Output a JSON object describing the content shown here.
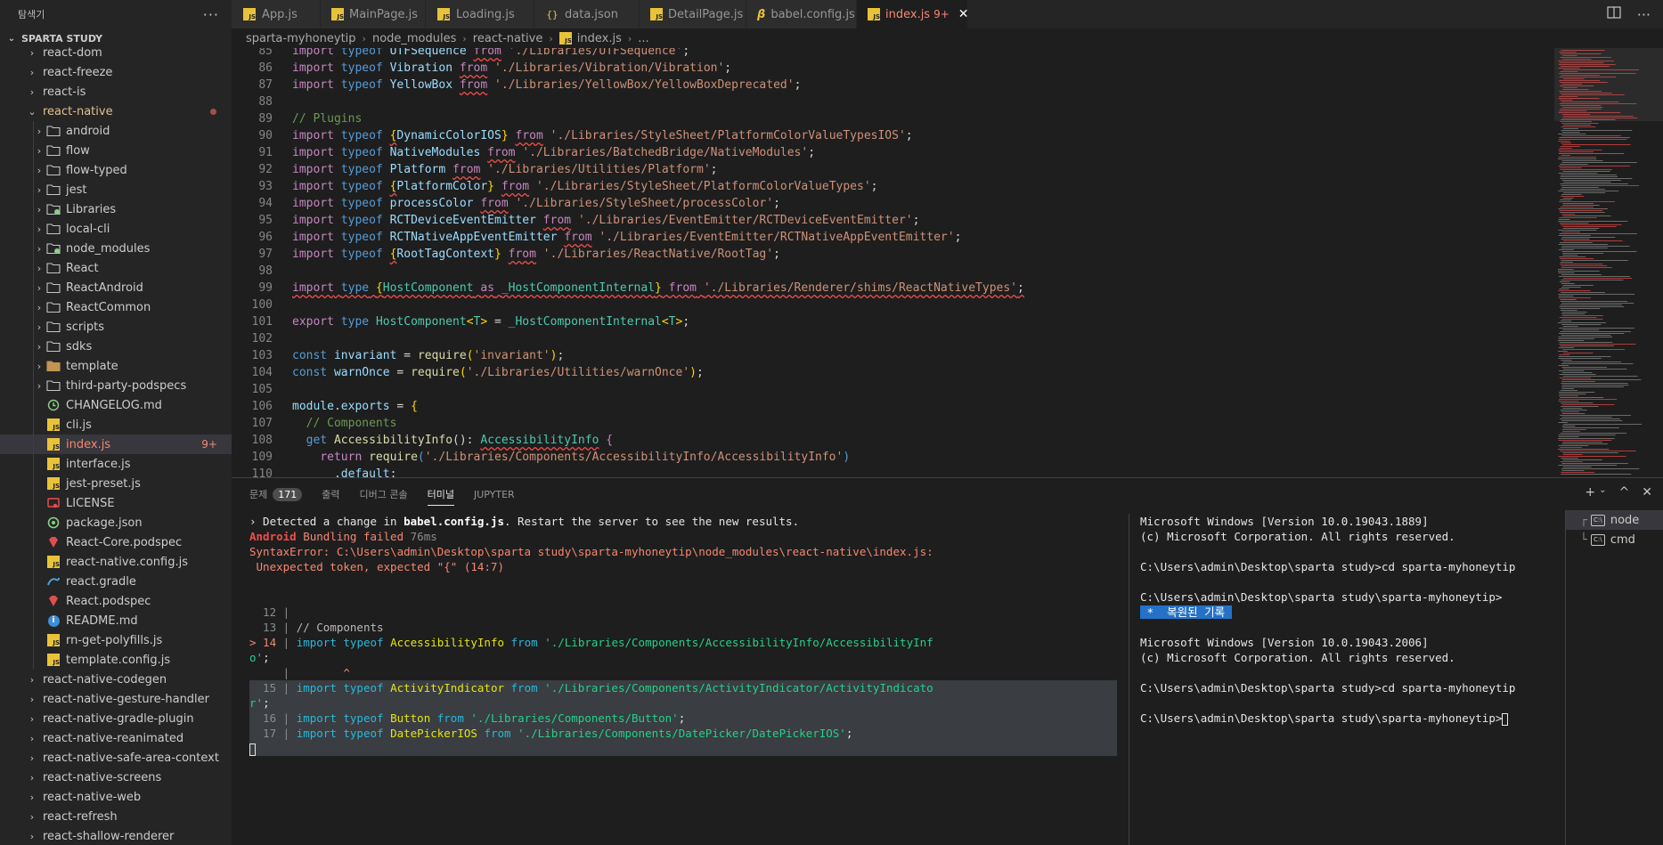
{
  "sidebar": {
    "title": "탐색기",
    "more": "···",
    "section": "SPARTA STUDY",
    "items": [
      {
        "label": "react-dom",
        "type": "folder",
        "level": 1,
        "expanded": false
      },
      {
        "label": "react-freeze",
        "type": "folder",
        "level": 1,
        "expanded": false
      },
      {
        "label": "react-is",
        "type": "folder",
        "level": 1,
        "expanded": false
      },
      {
        "label": "react-native",
        "type": "folder",
        "level": 1,
        "expanded": true,
        "modified": true
      },
      {
        "label": "android",
        "type": "folder",
        "level": 2,
        "expanded": false
      },
      {
        "label": "flow",
        "type": "folder",
        "level": 2,
        "expanded": false
      },
      {
        "label": "flow-typed",
        "type": "folder",
        "level": 2,
        "expanded": false
      },
      {
        "label": "jest",
        "type": "folder",
        "level": 2,
        "expanded": false
      },
      {
        "label": "Libraries",
        "type": "folder-lib",
        "level": 2,
        "expanded": false
      },
      {
        "label": "local-cli",
        "type": "folder",
        "level": 2,
        "expanded": false
      },
      {
        "label": "node_modules",
        "type": "folder-node",
        "level": 2,
        "expanded": false
      },
      {
        "label": "React",
        "type": "folder",
        "level": 2,
        "expanded": false
      },
      {
        "label": "ReactAndroid",
        "type": "folder",
        "level": 2,
        "expanded": false
      },
      {
        "label": "ReactCommon",
        "type": "folder",
        "level": 2,
        "expanded": false
      },
      {
        "label": "scripts",
        "type": "folder",
        "level": 2,
        "expanded": false
      },
      {
        "label": "sdks",
        "type": "folder",
        "level": 2,
        "expanded": false
      },
      {
        "label": "template",
        "type": "folder-tpl",
        "level": 2,
        "expanded": false
      },
      {
        "label": "third-party-podspecs",
        "type": "folder",
        "level": 2,
        "expanded": false
      },
      {
        "label": "CHANGELOG.md",
        "type": "file-changelog",
        "level": 2
      },
      {
        "label": "cli.js",
        "type": "file-js",
        "level": 2
      },
      {
        "label": "index.js",
        "type": "file-js",
        "level": 2,
        "active": true,
        "badge": "9+"
      },
      {
        "label": "interface.js",
        "type": "file-js",
        "level": 2
      },
      {
        "label": "jest-preset.js",
        "type": "file-js",
        "level": 2
      },
      {
        "label": "LICENSE",
        "type": "file-license",
        "level": 2
      },
      {
        "label": "package.json",
        "type": "file-npm",
        "level": 2
      },
      {
        "label": "React-Core.podspec",
        "type": "file-ruby",
        "level": 2
      },
      {
        "label": "react-native.config.js",
        "type": "file-js",
        "level": 2
      },
      {
        "label": "react.gradle",
        "type": "file-gradle",
        "level": 2
      },
      {
        "label": "React.podspec",
        "type": "file-ruby",
        "level": 2
      },
      {
        "label": "README.md",
        "type": "file-info",
        "level": 2
      },
      {
        "label": "rn-get-polyfills.js",
        "type": "file-js",
        "level": 2
      },
      {
        "label": "template.config.js",
        "type": "file-js",
        "level": 2
      },
      {
        "label": "react-native-codegen",
        "type": "folder",
        "level": 1,
        "expanded": false
      },
      {
        "label": "react-native-gesture-handler",
        "type": "folder",
        "level": 1,
        "expanded": false
      },
      {
        "label": "react-native-gradle-plugin",
        "type": "folder",
        "level": 1,
        "expanded": false
      },
      {
        "label": "react-native-reanimated",
        "type": "folder",
        "level": 1,
        "expanded": false
      },
      {
        "label": "react-native-safe-area-context",
        "type": "folder",
        "level": 1,
        "expanded": false
      },
      {
        "label": "react-native-screens",
        "type": "folder",
        "level": 1,
        "expanded": false
      },
      {
        "label": "react-native-web",
        "type": "folder",
        "level": 1,
        "expanded": false
      },
      {
        "label": "react-refresh",
        "type": "folder",
        "level": 1,
        "expanded": false
      },
      {
        "label": "react-shallow-renderer",
        "type": "folder",
        "level": 1,
        "expanded": false
      }
    ]
  },
  "tabs": [
    {
      "label": "App.js",
      "icon": "js"
    },
    {
      "label": "MainPage.js",
      "icon": "js"
    },
    {
      "label": "Loading.js",
      "icon": "js"
    },
    {
      "label": "data.json",
      "icon": "json"
    },
    {
      "label": "DetailPage.js",
      "icon": "js"
    },
    {
      "label": "babel.config.js",
      "icon": "babel"
    },
    {
      "label": "index.js",
      "icon": "js",
      "active": true,
      "badge": "9+",
      "close": "✕"
    }
  ],
  "breadcrumb": [
    "sparta-myhoneytip",
    "node_modules",
    "react-native",
    "index.js",
    "..."
  ],
  "editor": {
    "lines": [
      {
        "n": "85",
        "html": "<span class='kw2'>import</span> <span class='kw'>typeof</span> <span class='id'>UTFSequence</span> <span class='kw2 sq'>from</span> <span class='st'>'./Libraries/UTFSequence'</span>;"
      },
      {
        "n": "86",
        "html": "<span class='kw2'>import</span> <span class='kw'>typeof</span> <span class='id'>Vibration</span> <span class='kw2 sq'>from</span> <span class='st'>'./Libraries/Vibration/Vibration'</span>;"
      },
      {
        "n": "87",
        "html": "<span class='kw2'>import</span> <span class='kw'>typeof</span> <span class='id'>YellowBox</span> <span class='kw2 sq'>from</span> <span class='st'>'./Libraries/YellowBox/YellowBoxDeprecated'</span>;"
      },
      {
        "n": "88",
        "html": ""
      },
      {
        "n": "89",
        "html": "<span class='cm'>// Plugins</span>"
      },
      {
        "n": "90",
        "html": "<span class='kw2'>import</span> <span class='kw'>typeof</span> <span class='br sq'>{</span><span class='id'>DynamicColorIOS</span><span class='br'>}</span> <span class='kw2 sq'>from</span> <span class='st'>'./Libraries/StyleSheet/PlatformColorValueTypesIOS'</span>;"
      },
      {
        "n": "91",
        "html": "<span class='kw2'>import</span> <span class='kw'>typeof</span> <span class='id'>NativeModules</span> <span class='kw2 sq'>from</span> <span class='st'>'./Libraries/BatchedBridge/NativeModules'</span>;"
      },
      {
        "n": "92",
        "html": "<span class='kw2'>import</span> <span class='kw'>typeof</span> <span class='id'>Platform</span> <span class='kw2 sq'>from</span> <span class='st'>'./Libraries/Utilities/Platform'</span>;"
      },
      {
        "n": "93",
        "html": "<span class='kw2'>import</span> <span class='kw'>typeof</span> <span class='br sq'>{</span><span class='id'>PlatformColor</span><span class='br'>}</span> <span class='kw2 sq'>from</span> <span class='st'>'./Libraries/StyleSheet/PlatformColorValueTypes'</span>;"
      },
      {
        "n": "94",
        "html": "<span class='kw2'>import</span> <span class='kw'>typeof</span> <span class='id'>processColor</span> <span class='kw2 sq'>from</span> <span class='st'>'./Libraries/StyleSheet/processColor'</span>;"
      },
      {
        "n": "95",
        "html": "<span class='kw2'>import</span> <span class='kw'>typeof</span> <span class='id'>RCTDeviceEventEmitter</span> <span class='kw2 sq'>from</span> <span class='st'>'./Libraries/EventEmitter/RCTDeviceEventEmitter'</span>;"
      },
      {
        "n": "96",
        "html": "<span class='kw2'>import</span> <span class='kw'>typeof</span> <span class='id'>RCTNativeAppEventEmitter</span> <span class='kw2 sq'>from</span> <span class='st'>'./Libraries/EventEmitter/RCTNativeAppEventEmitter'</span>;"
      },
      {
        "n": "97",
        "html": "<span class='kw2'>import</span> <span class='kw'>typeof</span> <span class='br sq'>{</span><span class='id'>RootTagContext</span><span class='br'>}</span> <span class='kw2 sq'>from</span> <span class='st'>'./Libraries/ReactNative/RootTag'</span>;"
      },
      {
        "n": "98",
        "html": ""
      },
      {
        "n": "99",
        "html": "<span class='sq'><span class='kw2'>import</span> <span class='kw'>type</span> <span class='br'>{</span><span class='ty'>HostComponent</span> <span class='kw2'>as</span> <span class='ty'>_HostComponentInternal</span><span class='br'>}</span> <span class='kw2'>from</span> <span class='st'>'./Libraries/Renderer/shims/ReactNativeTypes'</span>;</span>"
      },
      {
        "n": "100",
        "html": ""
      },
      {
        "n": "101",
        "html": "<span class='kw2'>export</span> <span class='kw'>type</span> <span class='ty'>HostComponent</span><span class='br'>&lt;</span><span class='ty'>T</span><span class='br'>&gt;</span> = <span class='ty'>_HostComponentInternal</span><span class='br'>&lt;</span><span class='ty'>T</span><span class='br'>&gt;</span>;"
      },
      {
        "n": "102",
        "html": ""
      },
      {
        "n": "103",
        "html": "<span class='kw'>const</span> <span class='id'>invariant</span> = <span class='fn'>require</span><span class='br'>(</span><span class='st'>'invariant'</span><span class='br'>)</span>;"
      },
      {
        "n": "104",
        "html": "<span class='kw'>const</span> <span class='id'>warnOnce</span> = <span class='fn'>require</span><span class='br'>(</span><span class='st'>'./Libraries/Utilities/warnOnce'</span><span class='br'>)</span>;"
      },
      {
        "n": "105",
        "html": ""
      },
      {
        "n": "106",
        "html": "<span class='id'>module</span>.<span class='id'>exports</span> = <span class='br'>{</span>"
      },
      {
        "n": "107",
        "html": "  <span class='cm'>// Components</span>"
      },
      {
        "n": "108",
        "html": "  <span class='kw'>get</span> <span class='fn'>AccessibilityInfo</span>(): <span class='ty sq'>AccessibilityInfo</span> <span class='kw2'>{</span>"
      },
      {
        "n": "109",
        "html": "    <span class='kw2'>return</span> <span class='fn'>require</span><span class='kw'>(</span><span class='st'>'./Libraries/Components/AccessibilityInfo/AccessibilityInfo'</span><span class='kw'>)</span>"
      },
      {
        "n": "110",
        "html": "      <span class='id'>.default</span>;"
      }
    ]
  },
  "panel": {
    "tabs": [
      {
        "label": "문제",
        "badge": "171"
      },
      {
        "label": "출력"
      },
      {
        "label": "디버그 콘솔"
      },
      {
        "label": "터미널",
        "active": true
      },
      {
        "label": "JUPYTER"
      }
    ],
    "terminal_left": [
      "<span class='t-white'>› Detected a change in </span><span class='t-bold'>babel.config.js</span><span class='t-white'>. Restart the server to see the new results.</span>",
      "<span class='t-redb'>Android</span> <span class='t-red'>Bundling failed </span><span class='t-grey'>76ms</span>",
      "<span class='t-red'>SyntaxError: C:\\Users\\admin\\Desktop\\sparta study\\sparta-myhoneytip\\node_modules\\react-native\\index.js:</span>",
      "<span class='t-red'> Unexpected token, expected \"{\" (14:7)</span>",
      "",
      "",
      "<span class='t-grey'>  12 |</span>",
      "<span class='t-grey'>  13 | </span><span class='t-mute'>// Components</span>",
      "<span class='t-red'>&gt; 14 </span><span class='t-grey'>| </span><span class='t-cyan'>import</span> <span class='t-cyan'>typeof</span> <span class='t-yel'>AccessibilityInfo</span> <span class='t-cyan'>from</span> <span class='t-grn'>'./Libraries/Components/AccessibilityInfo/AccessibilityInf</span>",
      "<span class='t-grn'>o'</span><span class='t-white'>;</span>",
      "<span class='t-grey'>     |</span>        <span class='t-red'>^</span>",
      "<span class='hl'><span class='t-grey'>  15 | </span><span class='t-cyan'>import</span> <span class='t-cyan'>typeof</span> <span class='t-yel'>ActivityIndicator</span> <span class='t-cyan'>from</span> <span class='t-grn'>'./Libraries/Components/ActivityIndicator/ActivityIndicato</span></span>",
      "<span class='hl'><span class='t-grn'>r'</span><span class='t-white'>;</span></span>",
      "<span class='hl'><span class='t-grey'>  16 | </span><span class='t-cyan'>import</span> <span class='t-cyan'>typeof</span> <span class='t-yel'>Button</span> <span class='t-cyan'>from</span> <span class='t-grn'>'./Libraries/Components/Button'</span><span class='t-white'>;</span></span>",
      "<span class='hl'><span class='t-grey'>  17 | </span><span class='t-cyan'>import</span> <span class='t-cyan'>typeof</span> <span class='t-yel'>DatePickerIOS</span> <span class='t-cyan'>from</span> <span class='t-grn'>'./Libraries/Components/DatePicker/DatePickerIOS'</span><span class='t-white'>;</span></span>",
      "<span class='hl'><span class='cursor-block'></span></span>"
    ],
    "terminal_right": [
      "Microsoft Windows [Version 10.0.19043.1889]",
      "(c) Microsoft Corporation. All rights reserved.",
      "",
      "C:\\Users\\admin\\Desktop\\sparta study&gt;cd sparta-myhoneytip",
      "",
      "C:\\Users\\admin\\Desktop\\sparta study\\sparta-myhoneytip&gt;",
      "<span class='restored'> *  복원된 기록 </span>",
      "",
      "Microsoft Windows [Version 10.0.19043.2006]",
      "(c) Microsoft Corporation. All rights reserved.",
      "",
      "C:\\Users\\admin\\Desktop\\sparta study&gt;cd sparta-myhoneytip",
      "",
      "C:\\Users\\admin\\Desktop\\sparta study\\sparta-myhoneytip&gt;<span class='cursor-block'></span>"
    ],
    "terminals": [
      {
        "label": "node",
        "active": true,
        "branch": "┌"
      },
      {
        "label": "cmd",
        "branch": "└"
      }
    ]
  },
  "colors": {
    "accent": "#f48771",
    "error": "#f14c4c",
    "active_row": "#37373d"
  }
}
